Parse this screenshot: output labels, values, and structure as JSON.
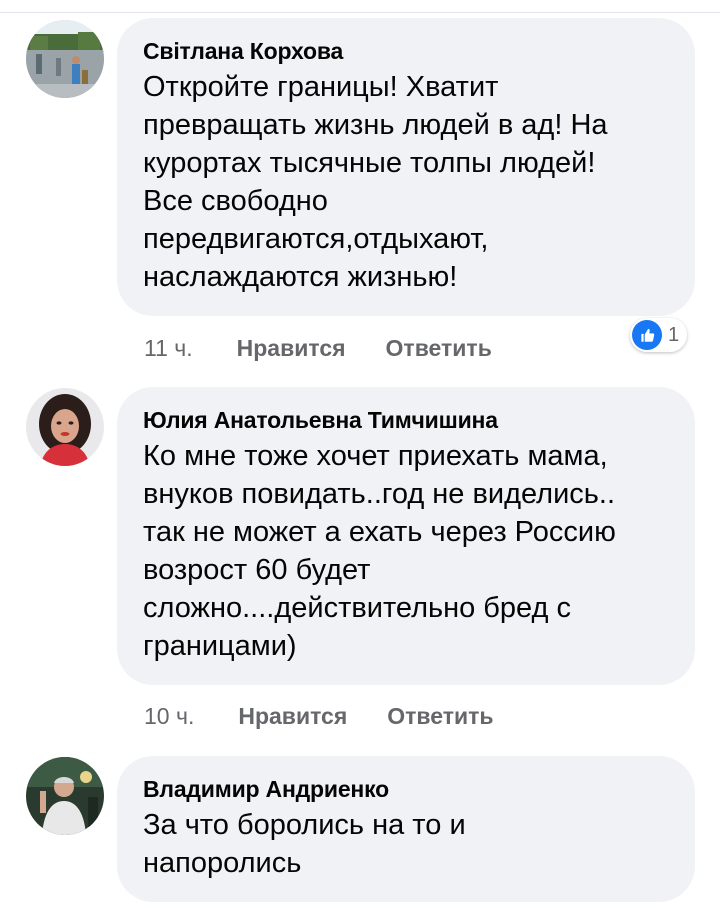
{
  "comments": [
    {
      "author": "Світлана Корхова",
      "text": "Откройте границы! Хватит\nпревращать жизнь людей в ад! На\nкурортах тысячные толпы людей!\nВсе свободно\nпередвигаются,отдыхают,\nнаслаждаются жизнью!",
      "time": "11 ч.",
      "like_label": "Нравится",
      "reply_label": "Ответить",
      "reaction_count": "1"
    },
    {
      "author": "Юлия Анатольевна Тимчишина",
      "text": "Ко мне тоже хочет приехать мама,\nвнуков повидать..год не виделись..\nтак не может а ехать через Россию\nвозрост 60 будет\nсложно....действительно бред с\nграницами)",
      "time": "10 ч.",
      "like_label": "Нравится",
      "reply_label": "Ответить"
    },
    {
      "author": "Владимир Андриенко",
      "text": "За что боролись на то и\nнапоролись"
    }
  ],
  "colors": {
    "bubble": "#f0f2f5",
    "meta": "#65676b",
    "like_blue": "#1877f2"
  },
  "icons": {
    "reaction": "thumbs-up-icon"
  }
}
